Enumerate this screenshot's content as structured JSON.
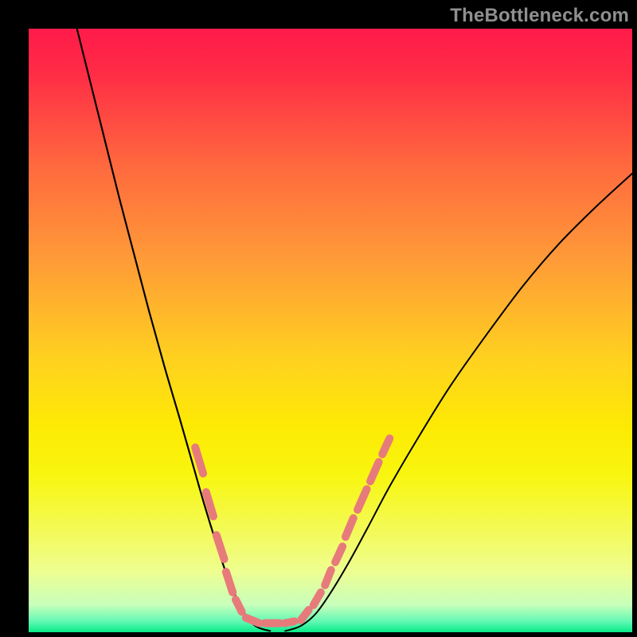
{
  "watermark": "TheBottleneck.com",
  "chart_data": {
    "type": "line",
    "title": "",
    "xlabel": "",
    "ylabel": "",
    "xlim": [
      0,
      100
    ],
    "ylim": [
      0,
      100
    ],
    "grid": false,
    "legend": false,
    "background_gradient": {
      "stops": [
        {
          "offset": 0.0,
          "color": "#ff1b4a"
        },
        {
          "offset": 0.07,
          "color": "#ff2b46"
        },
        {
          "offset": 0.23,
          "color": "#ff6a3e"
        },
        {
          "offset": 0.38,
          "color": "#ff9a38"
        },
        {
          "offset": 0.55,
          "color": "#ffd21f"
        },
        {
          "offset": 0.66,
          "color": "#fdea04"
        },
        {
          "offset": 0.74,
          "color": "#f8f60f"
        },
        {
          "offset": 0.85,
          "color": "#f2fb67"
        },
        {
          "offset": 0.9,
          "color": "#eefe91"
        },
        {
          "offset": 0.955,
          "color": "#c7ffbb"
        },
        {
          "offset": 0.982,
          "color": "#62f9b4"
        },
        {
          "offset": 1.0,
          "color": "#07eb87"
        }
      ]
    },
    "series": [
      {
        "name": "curve-left",
        "stroke": "#000000",
        "stroke_width": 2.2,
        "points": [
          {
            "x": 8.0,
            "y": 100.0
          },
          {
            "x": 10.0,
            "y": 92.0
          },
          {
            "x": 12.5,
            "y": 82.0
          },
          {
            "x": 15.0,
            "y": 72.0
          },
          {
            "x": 17.5,
            "y": 62.5
          },
          {
            "x": 20.0,
            "y": 53.0
          },
          {
            "x": 22.5,
            "y": 44.0
          },
          {
            "x": 25.0,
            "y": 35.5
          },
          {
            "x": 27.0,
            "y": 28.5
          },
          {
            "x": 29.0,
            "y": 21.5
          },
          {
            "x": 31.0,
            "y": 15.0
          },
          {
            "x": 33.0,
            "y": 9.0
          },
          {
            "x": 35.0,
            "y": 4.5
          },
          {
            "x": 36.5,
            "y": 2.0
          },
          {
            "x": 38.0,
            "y": 0.8
          },
          {
            "x": 40.0,
            "y": 0.2
          }
        ]
      },
      {
        "name": "curve-right",
        "stroke": "#000000",
        "stroke_width": 2.0,
        "points": [
          {
            "x": 42.5,
            "y": 0.2
          },
          {
            "x": 45.0,
            "y": 1.0
          },
          {
            "x": 47.5,
            "y": 3.0
          },
          {
            "x": 50.0,
            "y": 6.5
          },
          {
            "x": 53.0,
            "y": 11.5
          },
          {
            "x": 56.0,
            "y": 17.0
          },
          {
            "x": 60.0,
            "y": 24.5
          },
          {
            "x": 65.0,
            "y": 33.0
          },
          {
            "x": 70.0,
            "y": 41.0
          },
          {
            "x": 76.0,
            "y": 49.5
          },
          {
            "x": 82.0,
            "y": 57.5
          },
          {
            "x": 88.0,
            "y": 64.5
          },
          {
            "x": 94.0,
            "y": 70.5
          },
          {
            "x": 100.0,
            "y": 76.0
          }
        ]
      }
    ],
    "overlay_dashes": {
      "stroke": "#e77b7b",
      "stroke_width": 10,
      "linecap": "round",
      "segments": [
        {
          "x1": 27.6,
          "y1": 30.6,
          "x2": 28.9,
          "y2": 26.3
        },
        {
          "x1": 29.4,
          "y1": 23.2,
          "x2": 30.6,
          "y2": 19.2
        },
        {
          "x1": 31.1,
          "y1": 16.1,
          "x2": 32.4,
          "y2": 12.1
        },
        {
          "x1": 32.7,
          "y1": 10.0,
          "x2": 33.8,
          "y2": 6.6
        },
        {
          "x1": 34.3,
          "y1": 5.4,
          "x2": 35.3,
          "y2": 3.4
        },
        {
          "x1": 36.0,
          "y1": 2.4,
          "x2": 38.2,
          "y2": 1.5
        },
        {
          "x1": 39.1,
          "y1": 1.5,
          "x2": 41.6,
          "y2": 1.5
        },
        {
          "x1": 42.4,
          "y1": 1.5,
          "x2": 44.0,
          "y2": 1.8
        },
        {
          "x1": 45.1,
          "y1": 2.0,
          "x2": 46.4,
          "y2": 3.7
        },
        {
          "x1": 47.2,
          "y1": 4.5,
          "x2": 48.4,
          "y2": 6.6
        },
        {
          "x1": 49.1,
          "y1": 7.8,
          "x2": 50.1,
          "y2": 10.3
        },
        {
          "x1": 50.8,
          "y1": 11.6,
          "x2": 52.0,
          "y2": 14.2
        },
        {
          "x1": 52.5,
          "y1": 15.8,
          "x2": 53.8,
          "y2": 18.9
        },
        {
          "x1": 54.5,
          "y1": 20.3,
          "x2": 56.0,
          "y2": 23.7
        },
        {
          "x1": 56.6,
          "y1": 25.0,
          "x2": 58.0,
          "y2": 28.2
        },
        {
          "x1": 58.6,
          "y1": 29.5,
          "x2": 59.8,
          "y2": 32.1
        }
      ]
    }
  }
}
